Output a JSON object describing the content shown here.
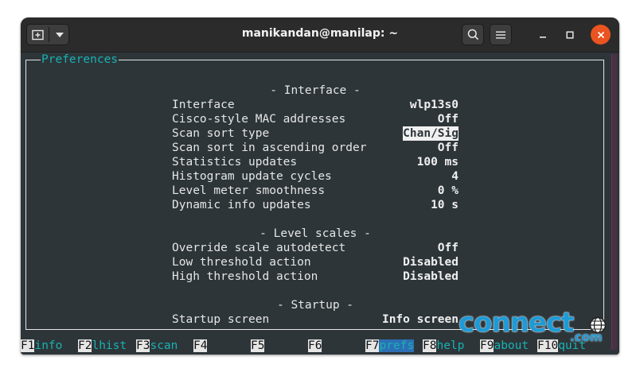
{
  "window": {
    "title": "manikandan@manilap: ~",
    "new_tab_icon": "new-tab-icon",
    "menu_icon": "chevron-down-icon",
    "search_icon": "search-icon",
    "hamburger_icon": "hamburger-icon",
    "minimize_icon": "minimize-icon",
    "maximize_icon": "maximize-icon",
    "close_icon": "close-icon",
    "close_color": "#e95420"
  },
  "preferences": {
    "frame_title": "Preferences",
    "sections": [
      {
        "heading": "- Interface -",
        "rows": [
          {
            "label": "Interface",
            "value": "wlp13s0"
          },
          {
            "label": "Cisco-style MAC addresses",
            "value": "Off"
          },
          {
            "label": "Scan sort type",
            "value": "Chan/Sig"
          },
          {
            "label": "Scan sort in ascending order",
            "value": "Off"
          },
          {
            "label": "Statistics updates",
            "value": "100 ms"
          },
          {
            "label": "Histogram update cycles",
            "value": "4"
          },
          {
            "label": "Level meter smoothness",
            "value": "0 %"
          },
          {
            "label": "Dynamic info updates",
            "value": "10 s"
          }
        ]
      },
      {
        "heading": "- Level scales -",
        "rows": [
          {
            "label": "Override scale autodetect",
            "value": "Off"
          },
          {
            "label": "Low threshold action",
            "value": "Disabled"
          },
          {
            "label": "High threshold action",
            "value": "Disabled"
          }
        ]
      },
      {
        "heading": "- Startup -",
        "rows": [
          {
            "label": "Startup screen",
            "value": "Info screen"
          }
        ]
      }
    ]
  },
  "fkeys": [
    {
      "key": "F1",
      "label": "info"
    },
    {
      "key": "F2",
      "label": "lhist"
    },
    {
      "key": "F3",
      "label": "scan"
    },
    {
      "key": "F4",
      "label": ""
    },
    {
      "key": "F5",
      "label": ""
    },
    {
      "key": "F6",
      "label": ""
    },
    {
      "key": "F7",
      "label": "prefs"
    },
    {
      "key": "F8",
      "label": "help"
    },
    {
      "key": "F9",
      "label": "about"
    },
    {
      "key": "F10",
      "label": "quit"
    }
  ],
  "watermark": {
    "text_big": "connect",
    "text_small": ".com",
    "color": "#1e9ad6"
  }
}
